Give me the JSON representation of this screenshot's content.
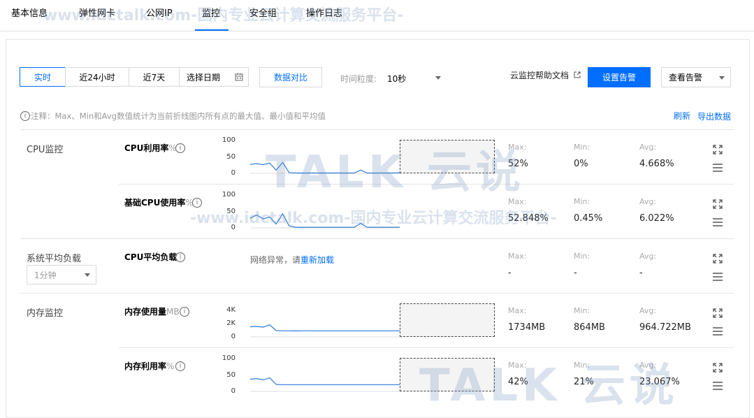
{
  "nav": {
    "tabs": [
      "基本信息",
      "弹性网卡",
      "公网IP",
      "监控",
      "安全组",
      "操作日志"
    ],
    "active": "监控"
  },
  "toolbar": {
    "realtime": "实时",
    "last24h": "近24小时",
    "last7d": "近7天",
    "pick_date": "选择日期",
    "compare": "数据对比",
    "granularity_label": "时间粒度:",
    "granularity_value": "10秒",
    "help_doc": "云监控帮助文档",
    "set_alarm": "设置告警",
    "view_alarm": "查看告警"
  },
  "note": "注释：Max、Min和Avg数值统计为当前折线图内所有点的最大值、最小值和平均值",
  "actions": {
    "refresh": "刷新",
    "export": "导出数据"
  },
  "stat_labels": {
    "max": "Max:",
    "min": "Min:",
    "avg": "Avg:"
  },
  "sections": {
    "cpu": {
      "title": "CPU监控",
      "metrics": [
        {
          "name": "CPU利用率",
          "unit": "%",
          "yticks": [
            "100",
            "50",
            "0"
          ],
          "max": "52%",
          "min": "0%",
          "avg": "4.668%"
        },
        {
          "name": "基础CPU使用率",
          "unit": "%",
          "yticks": [
            "100",
            "50",
            "0"
          ],
          "max": "52.848%",
          "min": "0.45%",
          "avg": "6.022%"
        }
      ]
    },
    "load": {
      "title": "系统平均负载",
      "interval": "1分钟",
      "metric": {
        "name": "CPU平均负载",
        "error_text": "网络异常，请",
        "reload": "重新加载",
        "max": "-",
        "min": "-",
        "avg": "-"
      }
    },
    "memory": {
      "title": "内存监控",
      "metrics": [
        {
          "name": "内存使用量",
          "unit": "MB",
          "yticks": [
            "4K",
            "2K",
            "0"
          ],
          "max": "1734MB",
          "min": "864MB",
          "avg": "964.722MB"
        },
        {
          "name": "内存利用率",
          "unit": "%",
          "yticks": [
            "100",
            "50",
            "0"
          ],
          "max": "42%",
          "min": "21%",
          "avg": "23.067%"
        }
      ]
    }
  },
  "watermarks": {
    "top": "www.idctalk.com-国内专业云计算交流服务平台-",
    "mid": "-www.idctalk.com-国内专业云计算交流服务平台-",
    "brand": "TALK 云说"
  },
  "chart_data": [
    {
      "type": "line",
      "title": "CPU利用率",
      "ylim": [
        0,
        100
      ],
      "series": [
        {
          "values": [
            28,
            30,
            27,
            32,
            10,
            34,
            2,
            1,
            1,
            1,
            1,
            1,
            1,
            1,
            1,
            1,
            1,
            10,
            1,
            1,
            1,
            1,
            1,
            2
          ]
        }
      ]
    },
    {
      "type": "line",
      "title": "基础CPU使用率",
      "ylim": [
        0,
        100
      ],
      "series": [
        {
          "values": [
            30,
            40,
            28,
            34,
            12,
            44,
            6,
            2,
            2,
            2,
            2,
            2,
            2,
            2,
            2,
            2,
            2,
            14,
            2,
            2,
            2,
            2,
            2,
            2
          ]
        }
      ]
    },
    {
      "type": "line",
      "title": "内存使用量",
      "ylim": [
        0,
        4000
      ],
      "series": [
        {
          "values": [
            1450,
            1500,
            1400,
            1734,
            900,
            880,
            870,
            864,
            870,
            880,
            870,
            870,
            870,
            870,
            870,
            870,
            870,
            870,
            870,
            870,
            870,
            870,
            870,
            870
          ]
        }
      ]
    },
    {
      "type": "line",
      "title": "内存利用率",
      "ylim": [
        0,
        100
      ],
      "series": [
        {
          "values": [
            38,
            40,
            36,
            42,
            22,
            21,
            21,
            21,
            21,
            21,
            21,
            21,
            21,
            21,
            21,
            21,
            21,
            21,
            21,
            21,
            21,
            21,
            21,
            21
          ]
        }
      ]
    }
  ]
}
